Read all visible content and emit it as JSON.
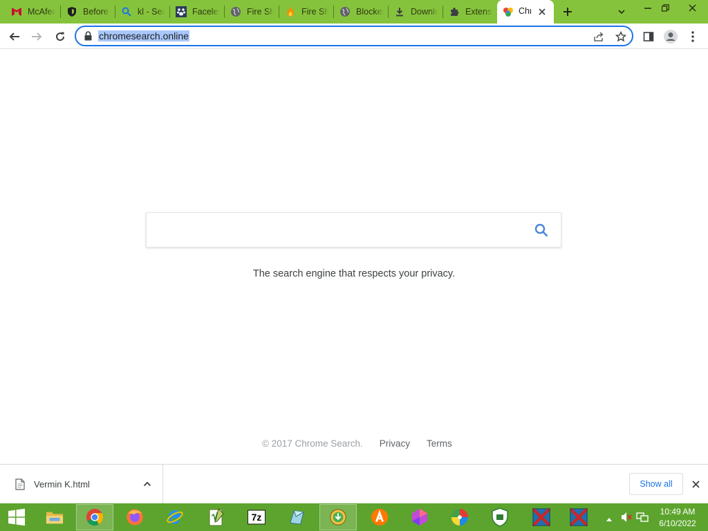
{
  "browser": {
    "tabs": [
      {
        "title": "McAfee",
        "icon": "mcafee-icon"
      },
      {
        "title": "Before",
        "icon": "shield-icon"
      },
      {
        "title": "kl - Sea",
        "icon": "search-icon"
      },
      {
        "title": "Faceless",
        "icon": "paw-icon"
      },
      {
        "title": "Fire Sh",
        "icon": "globe-icon"
      },
      {
        "title": "Fire Sh",
        "icon": "fire-icon"
      },
      {
        "title": "Blocker",
        "icon": "globe-icon"
      },
      {
        "title": "Downlo",
        "icon": "download-icon"
      },
      {
        "title": "Extensi",
        "icon": "puzzle-icon"
      }
    ],
    "active_tab": {
      "title": "Chr",
      "icon": "chrome-search-icon"
    },
    "url": "chromesearch.online"
  },
  "page": {
    "search_placeholder": "",
    "tagline": "The search engine that respects your privacy.",
    "footer": {
      "copyright": "© 2017 Chrome Search.",
      "privacy": "Privacy",
      "terms": "Terms"
    }
  },
  "downloads": {
    "file_name": "Vermin K.html",
    "show_all": "Show all"
  },
  "taskbar": {
    "apps": [
      "file-explorer",
      "chrome",
      "firefox",
      "internet-explorer",
      "notepad-plus",
      "7zip",
      "scratchpad",
      "download-manager",
      "avast",
      "gem-app",
      "pinwheel-app",
      "security-app",
      "cube-app-1",
      "cube-app-2"
    ],
    "time": "10:49 AM",
    "date": "6/10/2022"
  },
  "colors": {
    "titlebar": "#86c33c",
    "taskbar": "#5da42e",
    "accent": "#1a73e8"
  }
}
